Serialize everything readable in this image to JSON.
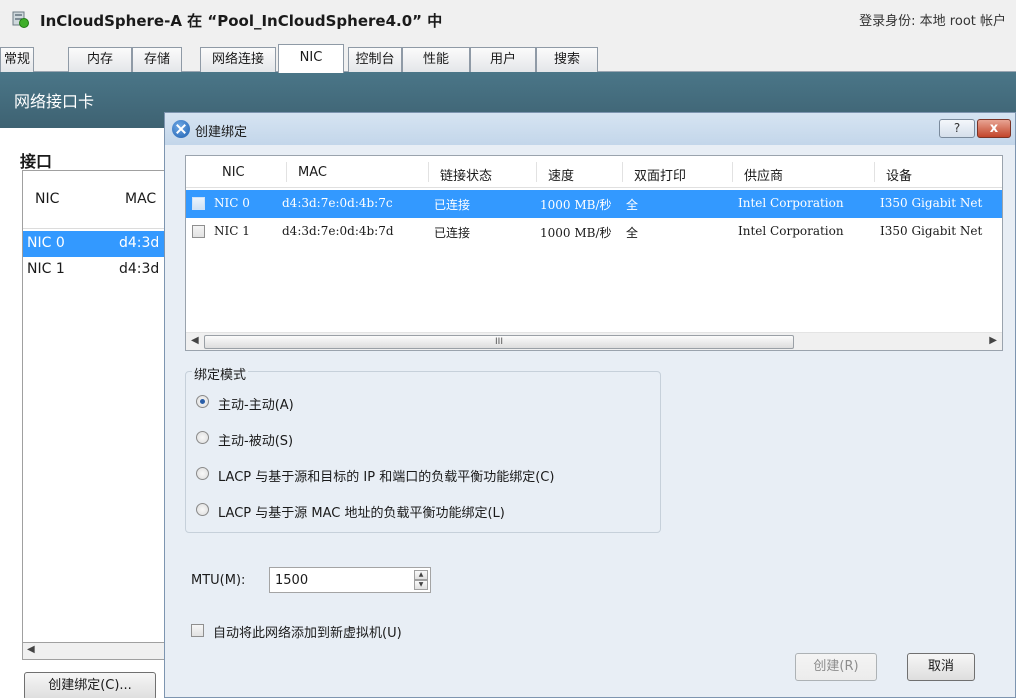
{
  "window": {
    "title": "InCloudSphere-A 在 “Pool_InCloudSphere4.0” 中",
    "login_status": "登录身份: 本地 root 帐户"
  },
  "tabs": [
    {
      "label": "常规"
    },
    {
      "label": "内存"
    },
    {
      "label": "存储"
    },
    {
      "label": "网络连接"
    },
    {
      "label": "NIC",
      "active": true
    },
    {
      "label": "控制台"
    },
    {
      "label": "性能"
    },
    {
      "label": "用户"
    },
    {
      "label": "搜索"
    }
  ],
  "section": {
    "title": "网络接口卡",
    "interfaces_label": "接口"
  },
  "bg_list": {
    "columns": [
      "NIC",
      "MAC"
    ],
    "rows": [
      {
        "nic": "NIC 0",
        "mac": "d4:3d",
        "selected": true
      },
      {
        "nic": "NIC 1",
        "mac": "d4:3d",
        "selected": false
      }
    ],
    "create_bond_button": "创建绑定(C)..."
  },
  "dialog": {
    "title": "创建绑定",
    "help_label": "?",
    "close_label": "x",
    "grid": {
      "columns": [
        "NIC",
        "MAC",
        "链接状态",
        "速度",
        "双面打印",
        "供应商",
        "设备"
      ],
      "rows": [
        {
          "nic": "NIC 0",
          "mac": "d4:3d:7e:0d:4b:7c",
          "link": "已连接",
          "speed": "1000 MB/秒",
          "duplex": "全",
          "vendor": "Intel Corporation",
          "device": "I350 Gigabit Net",
          "checked": false,
          "selected": true
        },
        {
          "nic": "NIC 1",
          "mac": "d4:3d:7e:0d:4b:7d",
          "link": "已连接",
          "speed": "1000 MB/秒",
          "duplex": "全",
          "vendor": "Intel Corporation",
          "device": "I350 Gigabit Net",
          "checked": false,
          "selected": false
        }
      ],
      "scroll_grip": "III"
    },
    "bond_mode": {
      "label": "绑定模式",
      "options": [
        {
          "label": "主动-主动(A)",
          "selected": true
        },
        {
          "label": "主动-被动(S)",
          "selected": false
        },
        {
          "label": "LACP 与基于源和目标的 IP 和端口的负载平衡功能绑定(C)",
          "selected": false
        },
        {
          "label": "LACP 与基于源 MAC 地址的负载平衡功能绑定(L)",
          "selected": false
        }
      ]
    },
    "mtu": {
      "label": "MTU(M):",
      "value": "1500"
    },
    "auto_add": {
      "label": "自动将此网络添加到新虚拟机(U)",
      "checked": false
    },
    "create_button": "创建(R)",
    "cancel_button": "取消"
  }
}
